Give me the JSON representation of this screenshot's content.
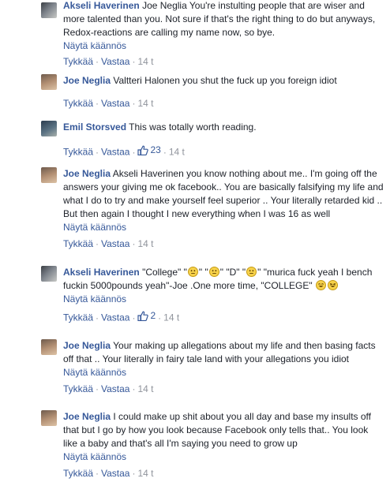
{
  "labels": {
    "translate": "Näytä käännös",
    "like": "Tykkää",
    "reply": "Vastaa",
    "separator": "·"
  },
  "comments": [
    {
      "author": "Akseli Haverinen",
      "text": "Joe Neglia You're instulting people that are wiser and more talented than you. Not sure if that's the right thing to do but anyways, Redox-reactions are calling my name now, so bye.",
      "time": "14 t",
      "likes": null
    },
    {
      "author": "Joe Neglia",
      "text": "Valtteri Halonen you shut the fuck up you foreign idiot",
      "time": "14 t",
      "likes": null
    },
    {
      "author": "Emil Storsved",
      "text": "This was totally worth reading.",
      "time": "14 t",
      "likes": "23"
    },
    {
      "author": "Joe Neglia",
      "text": "Akseli Haverinen you know nothing about me.. I'm going off the answers your giving me ok facebook.. You are basically falsifying my life and what I do to try and make yourself feel superior .. Your literally retarded kid .. But then again I thought I new everything when I was 16 as well",
      "time": "14 t",
      "likes": null
    },
    {
      "author": "Akseli Haverinen",
      "text_parts": [
        "\"College\" \"",
        "\" \"",
        "\" \"D\" \"",
        "\" \"murica fuck yeah I bench fuckin 5000pounds yeah\"-Joe .One more time, \"COLLEGE\" "
      ],
      "time": "14 t",
      "likes": "2"
    },
    {
      "author": "Joe Neglia",
      "text": "Your making up allegations about my life and then basing facts off that .. Your literally in fairy tale land with your allegations you idiot",
      "time": "14 t",
      "likes": null
    },
    {
      "author": "Joe Neglia",
      "text": "I could make up shit about you all day and base my insults off that but I go by how you look because Facebook only tells that.. You look like a baby and that's all I'm saying you need to grow up",
      "time": "14 t",
      "likes": null
    }
  ]
}
